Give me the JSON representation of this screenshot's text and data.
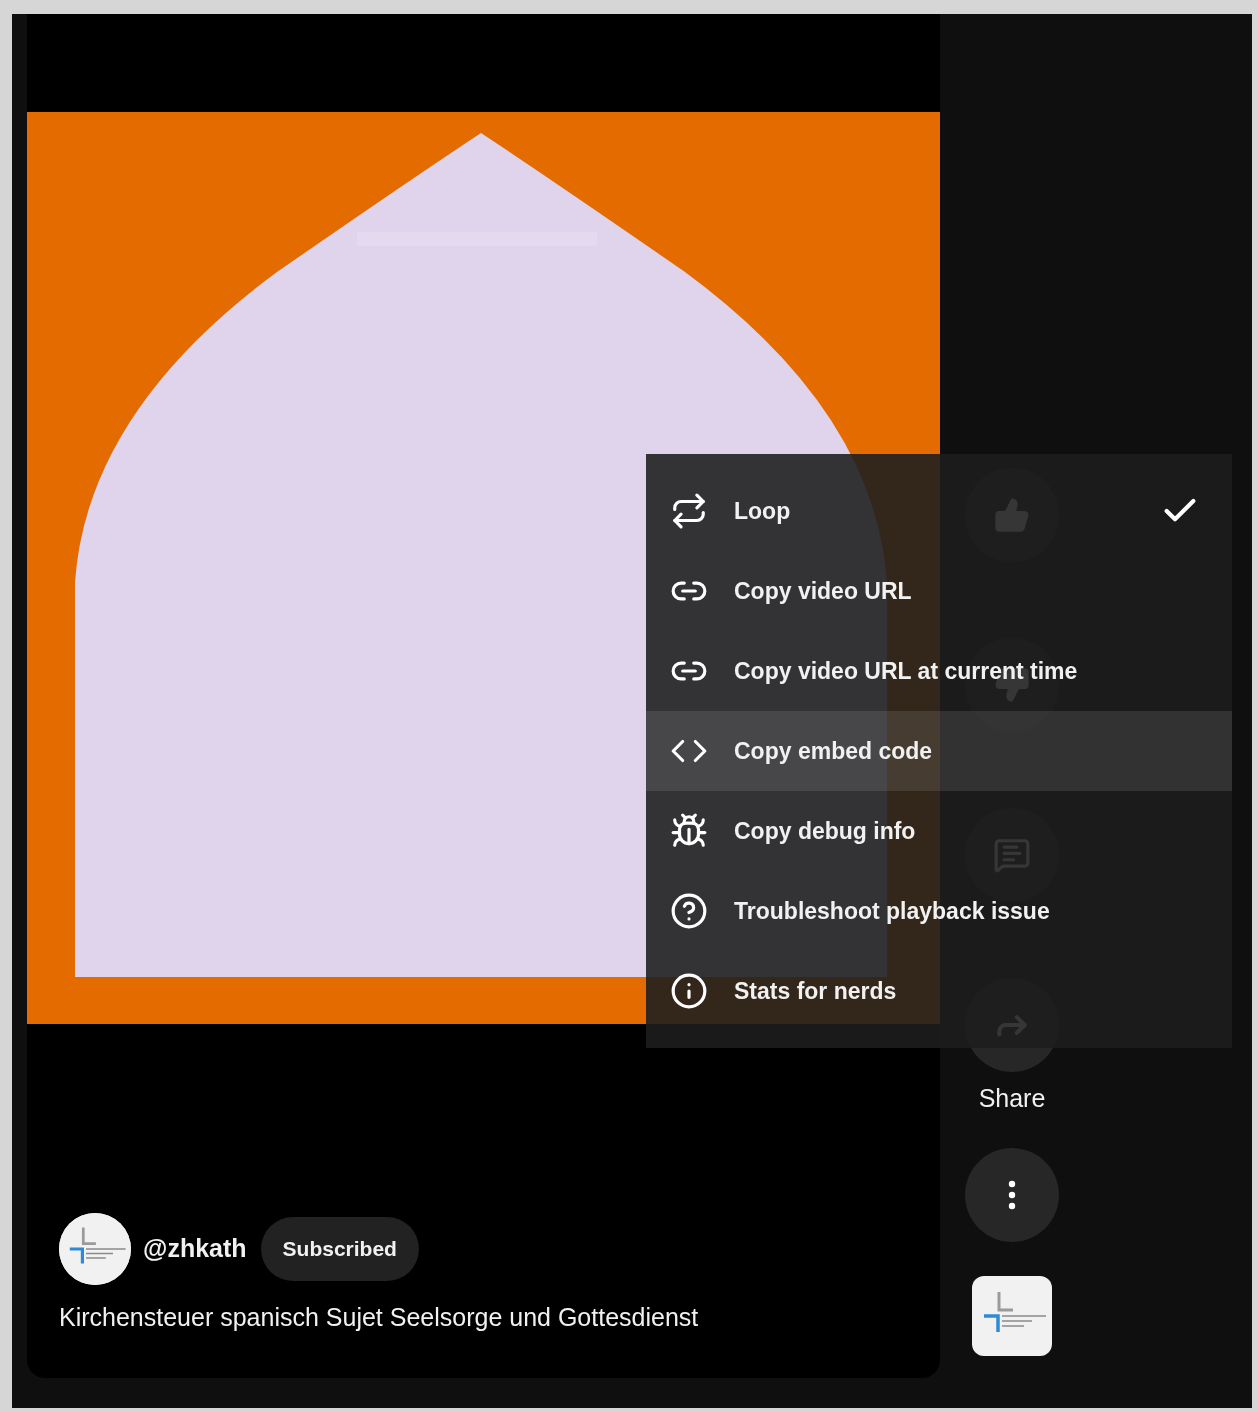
{
  "channel": {
    "handle": "@zhkath",
    "subscribe_button": "Subscribed",
    "title": "Kirchensteuer spanisch Sujet Seelsorge und Gottesdienst"
  },
  "actions": [
    {
      "kind": "like"
    },
    {
      "kind": "dislike"
    },
    {
      "kind": "comment"
    },
    {
      "kind": "share",
      "label": "Share"
    },
    {
      "kind": "more"
    }
  ],
  "menu": {
    "items": [
      {
        "kind": "loop",
        "label": "Loop",
        "checked": true,
        "selected": false
      },
      {
        "kind": "link",
        "label": "Copy video URL",
        "checked": false,
        "selected": false
      },
      {
        "kind": "link",
        "label": "Copy video URL at current time",
        "checked": false,
        "selected": false
      },
      {
        "kind": "embed",
        "label": "Copy embed code",
        "checked": false,
        "selected": true
      },
      {
        "kind": "debug",
        "label": "Copy debug info",
        "checked": false,
        "selected": false
      },
      {
        "kind": "help",
        "label": "Troubleshoot playback issue",
        "checked": false,
        "selected": false
      },
      {
        "kind": "info",
        "label": "Stats for nerds",
        "checked": false,
        "selected": false
      }
    ]
  }
}
